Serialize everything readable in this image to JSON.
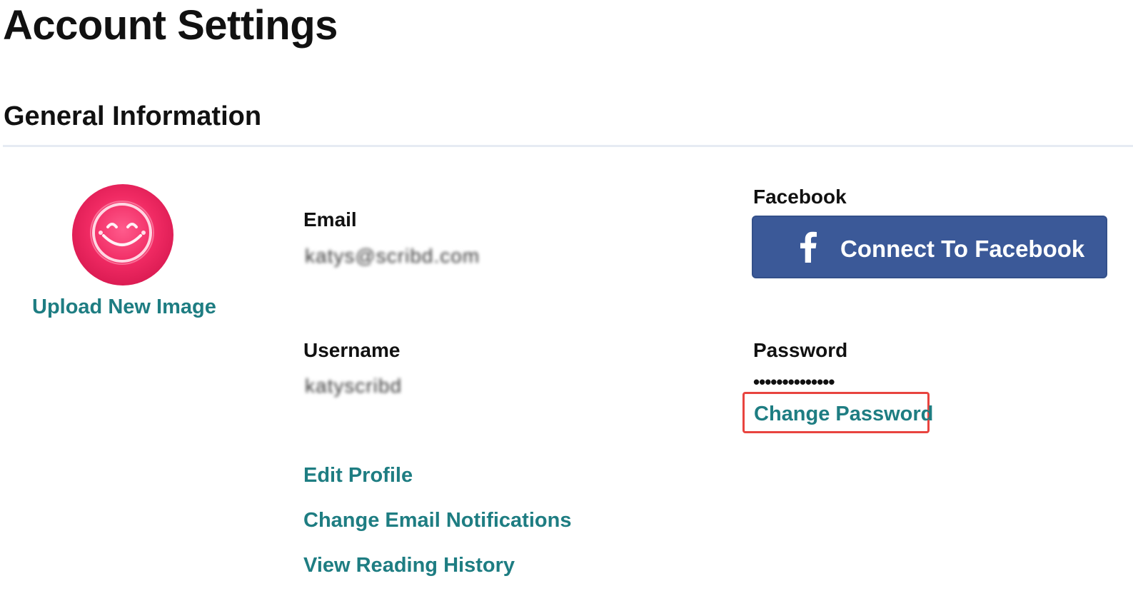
{
  "header": {
    "title": "Account Settings"
  },
  "general": {
    "section_title": "General Information",
    "avatar": {
      "icon": "neon-smiley-face-image",
      "upload_label": "Upload New Image"
    },
    "email": {
      "label": "Email",
      "value": "katys@scribd.com"
    },
    "username": {
      "label": "Username",
      "value": "katyscribd"
    },
    "facebook": {
      "label": "Facebook",
      "button_label": "Connect To Facebook",
      "icon": "facebook-f-icon",
      "button_color": "#3b5998"
    },
    "password": {
      "label": "Password",
      "masked_value": "••••••••••••••",
      "change_label": "Change Password",
      "highlight_color": "#e8443f"
    },
    "links": {
      "edit_profile": "Edit Profile",
      "email_notifications": "Change Email Notifications",
      "reading_history": "View Reading History"
    },
    "link_color": "#1e7d82"
  }
}
